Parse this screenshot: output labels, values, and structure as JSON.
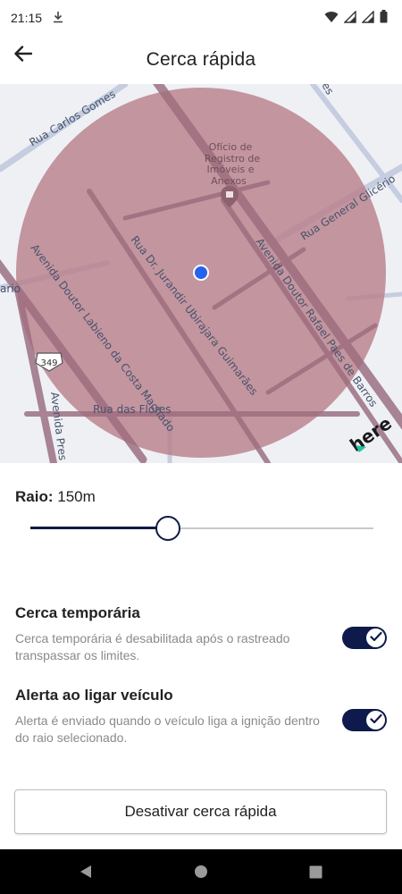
{
  "status_bar": {
    "time": "21:15",
    "download_icon": "download-icon",
    "icons": [
      "wifi-icon",
      "signal-icon",
      "signal-icon",
      "battery-icon"
    ]
  },
  "header": {
    "title": "Cerca rápida",
    "back_icon": "arrow-left-icon"
  },
  "map": {
    "streets": [
      "Rua Carlos Gomes",
      "Ofício de",
      "Registro de",
      "Imóveis e",
      "Anexos",
      "Rua General Glicério",
      "Rua Dr. Jurandir Ubirajara Guimarães",
      "Avenida Doutor Rafael Paes de Barros",
      "Avenida Doutor Labieno da Costa Machado",
      "Rua das Flores",
      "Avenida Pres",
      "ario",
      "es"
    ],
    "route_shield": "349",
    "provider_logo": "here",
    "fence_color": "#b9808c",
    "location_color": "#2563eb"
  },
  "radius": {
    "label": "Raio:",
    "value": "150m",
    "slider_fraction": 0.4
  },
  "settings": [
    {
      "title": "Cerca temporária",
      "description": "Cerca temporária é desabilitada após o rastreado transpassar os limites.",
      "enabled": true
    },
    {
      "title": "Alerta ao ligar veículo",
      "description": "Alerta é enviado quando o veículo liga a ignição dentro do raio selecionado.",
      "enabled": true
    }
  ],
  "actions": {
    "deactivate_label": "Desativar cerca rápida"
  },
  "nav_bar": {
    "icons": [
      "back-triangle-icon",
      "home-circle-icon",
      "recents-square-icon"
    ]
  },
  "colors": {
    "accent": "#0e1a4b"
  }
}
